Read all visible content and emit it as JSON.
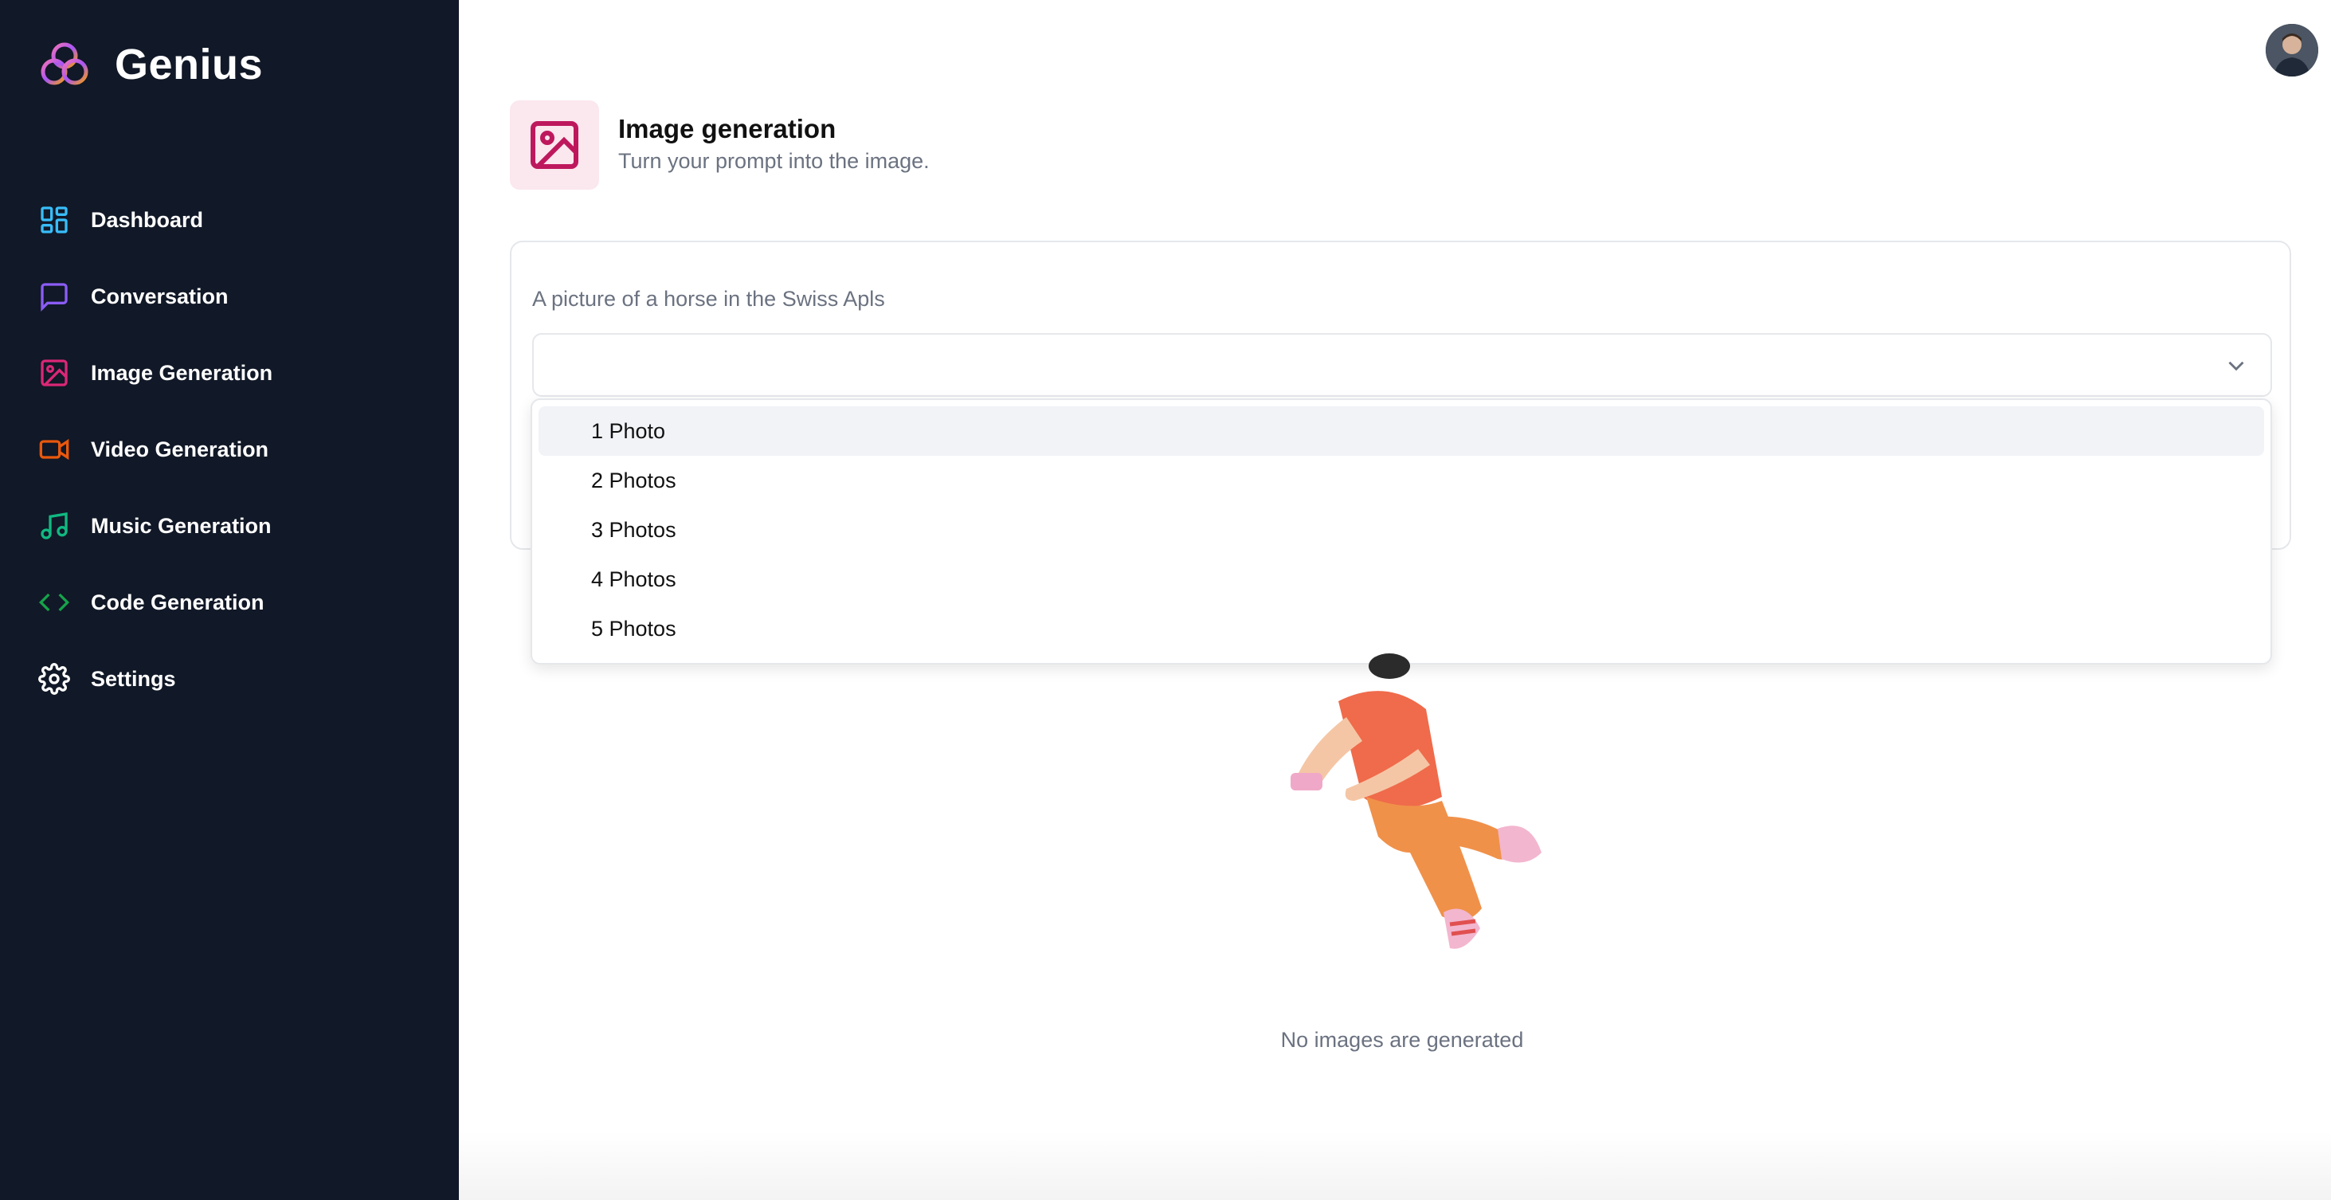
{
  "app": {
    "name": "Genius"
  },
  "sidebar": {
    "items": [
      {
        "label": "Dashboard",
        "icon": "dashboard-icon",
        "color": "#38bdf8"
      },
      {
        "label": "Conversation",
        "icon": "chat-icon",
        "color": "#8b5cf6"
      },
      {
        "label": "Image Generation",
        "icon": "image-icon",
        "color": "#db2777"
      },
      {
        "label": "Video Generation",
        "icon": "video-icon",
        "color": "#ea580c"
      },
      {
        "label": "Music Generation",
        "icon": "music-icon",
        "color": "#10b981"
      },
      {
        "label": "Code Generation",
        "icon": "code-icon",
        "color": "#16a34a"
      },
      {
        "label": "Settings",
        "icon": "gear-icon",
        "color": "#ffffff"
      }
    ]
  },
  "header": {
    "title": "Image generation",
    "subtitle": "Turn your prompt into the image.",
    "icon": "image-icon",
    "accent": "#be185d"
  },
  "form": {
    "prompt_value": "A picture of a horse in the Swiss Apls",
    "amount_value": "",
    "amount_options": [
      "1 Photo",
      "2 Photos",
      "3 Photos",
      "4 Photos",
      "5 Photos"
    ],
    "highlighted_option": "1 Photo"
  },
  "empty_state": {
    "text": "No images are generated"
  }
}
